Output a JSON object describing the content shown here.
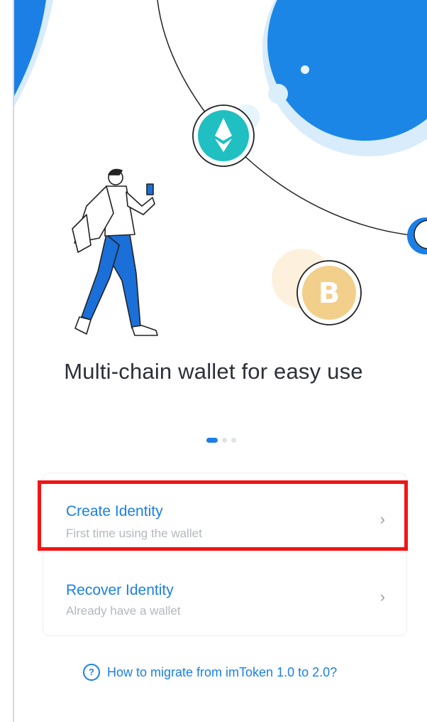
{
  "onboarding": {
    "title": "Multi-chain wallet for easy use",
    "pager": {
      "count": 3,
      "active": 0
    }
  },
  "options": {
    "create": {
      "label": "Create Identity",
      "sub": "First time using the wallet",
      "chevron": "›"
    },
    "recover": {
      "label": "Recover Identity",
      "sub": "Already have a wallet",
      "chevron": "›"
    }
  },
  "help": {
    "icon": "?",
    "text": "How to migrate from imToken 1.0 to 2.0?"
  },
  "illustration": {
    "coins": [
      "ethereum-coin-icon",
      "bitcoin-coin-icon"
    ],
    "bitcoin_symbol": "B"
  },
  "colors": {
    "accent": "#1b7fe6",
    "title": "#2d2f3a",
    "subtext": "#b3b7be",
    "highlight": "#f21414",
    "eth": "#1fbfc2",
    "btc": "#f2cf8b"
  }
}
